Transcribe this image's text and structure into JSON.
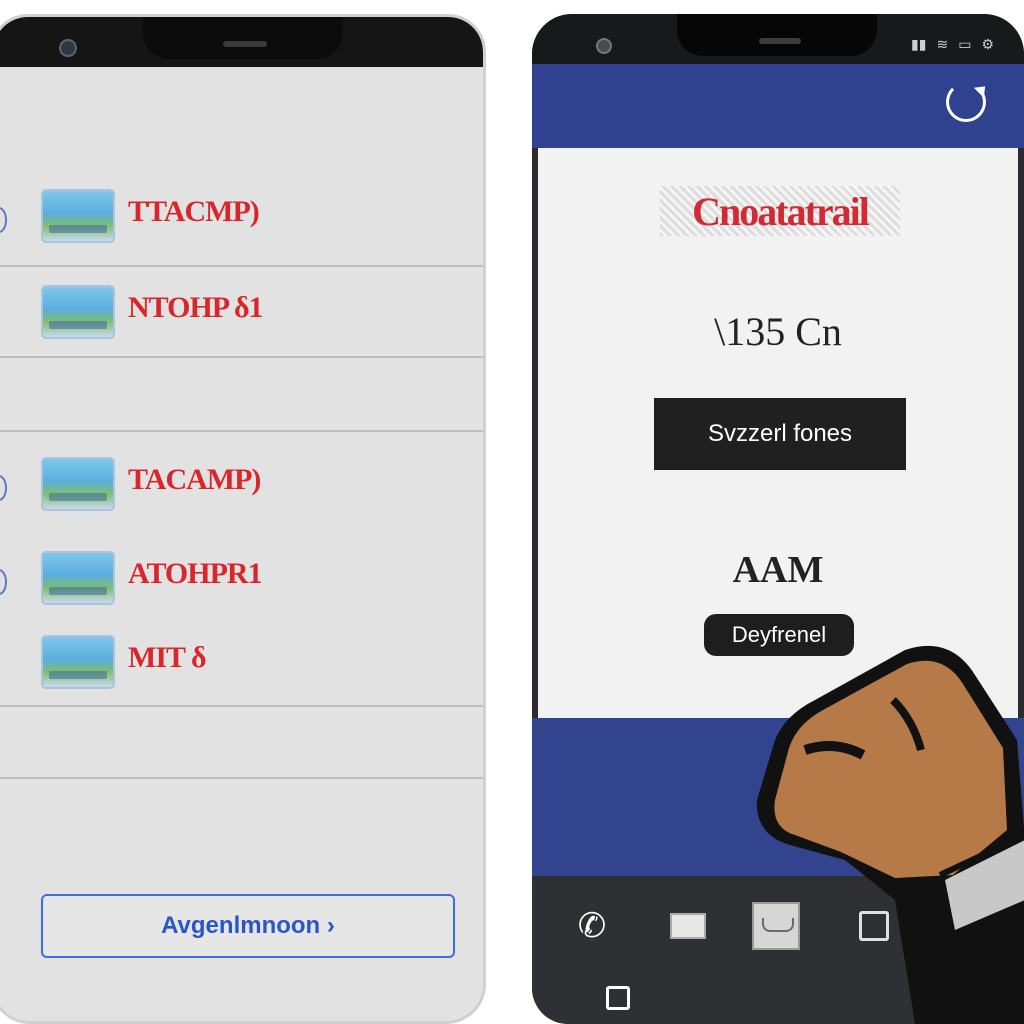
{
  "left_phone": {
    "items": [
      {
        "label": "TTACMP)"
      },
      {
        "label": "NTOHP δ1"
      },
      {
        "label": "TACAMP)"
      },
      {
        "label": "ATOHPR1"
      },
      {
        "label": "MIT δ"
      }
    ],
    "bottom_button": "Avgenlmnoon ›"
  },
  "right_phone": {
    "title": "Cnoatatrail",
    "price": "\\135 Cn",
    "primary_button": "Svzzerl fones",
    "sub_text": "AAM",
    "pill_button": "Deyfrenel"
  },
  "colors": {
    "app_bar": "#30428f",
    "label_red": "#d9262a",
    "link_blue": "#2a56c9"
  }
}
